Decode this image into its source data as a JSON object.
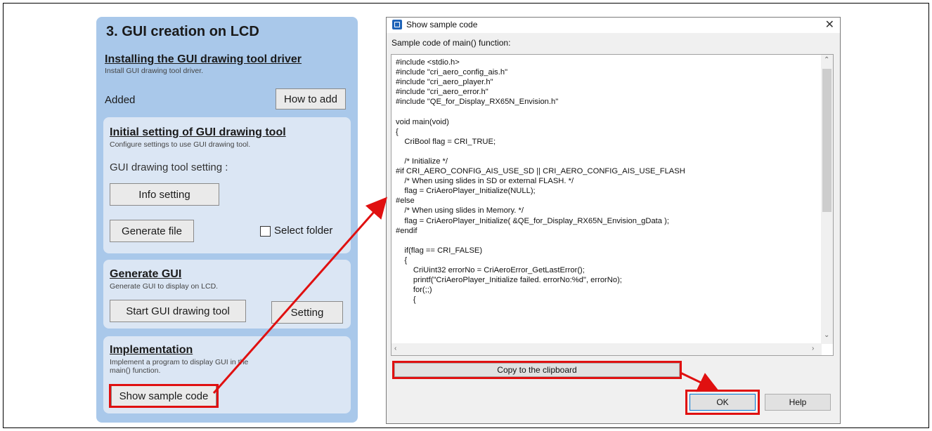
{
  "left_panel": {
    "title": "3. GUI creation on LCD",
    "install_heading": "Installing the GUI drawing tool driver",
    "install_sub": "Install GUI drawing tool driver.",
    "added_label": "Added",
    "how_to_add_label": "How to add",
    "initial_heading": "Initial setting of GUI drawing tool",
    "initial_sub": "Configure settings to use GUI drawing tool.",
    "tool_setting_label": "GUI drawing tool setting :",
    "info_setting_label": "Info setting",
    "generate_file_label": "Generate file",
    "select_folder_label": "Select folder",
    "generate_heading": "Generate GUI",
    "generate_sub": "Generate GUI to display on LCD.",
    "start_tool_label": "Start GUI drawing tool",
    "setting_label": "Setting",
    "impl_heading": "Implementation",
    "impl_sub": "Implement a program to display GUI in the main() function.",
    "show_sample_label": "Show sample code"
  },
  "dialog": {
    "title": "Show sample code",
    "close_glyph": "✕",
    "label": "Sample code of main() function:",
    "code": "#include <stdio.h>\n#include \"cri_aero_config_ais.h\"\n#include \"cri_aero_player.h\"\n#include \"cri_aero_error.h\"\n#include \"QE_for_Display_RX65N_Envision.h\"\n\nvoid main(void)\n{\n    CriBool flag = CRI_TRUE;\n\n    /* Initialize */\n#if CRI_AERO_CONFIG_AIS_USE_SD || CRI_AERO_CONFIG_AIS_USE_FLASH\n    /* When using slides in SD or external FLASH. */\n    flag = CriAeroPlayer_Initialize(NULL);\n#else\n    /* When using slides in Memory. */\n    flag = CriAeroPlayer_Initialize( &QE_for_Display_RX65N_Envision_gData );\n#endif\n\n    if(flag == CRI_FALSE)\n    {\n        CriUint32 errorNo = CriAeroError_GetLastError();\n        printf(\"CriAeroPlayer_Initialize failed. errorNo:%d\", errorNo);\n        for(;;)\n        {",
    "copy_label": "Copy to the clipboard",
    "ok_label": "OK",
    "help_label": "Help"
  },
  "colors": {
    "panel_bg": "#a9c8ea",
    "card_bg": "#dbe6f4",
    "highlight": "#e01010"
  }
}
